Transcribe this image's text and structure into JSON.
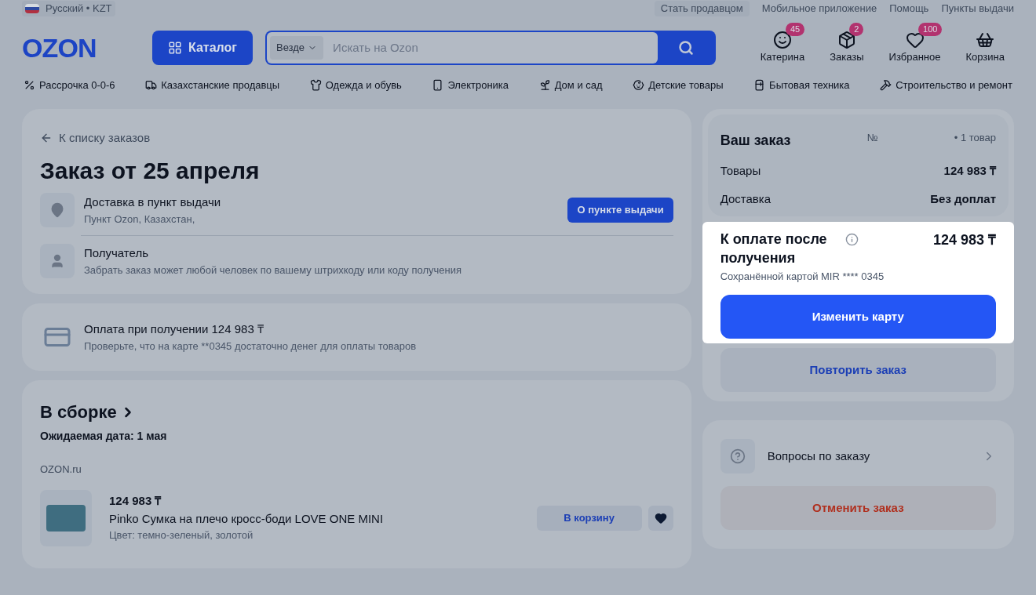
{
  "top_bar": {
    "locale": "Русский • KZT",
    "links": [
      "Стать продавцом",
      "Мобильное приложение",
      "Помощь",
      "Пункты выдачи"
    ]
  },
  "header": {
    "logo": "OZON",
    "catalog_button": "Каталог",
    "search": {
      "scope": "Везде",
      "placeholder": "Искать на Ozon"
    },
    "actions": [
      {
        "kind": "profile",
        "label": "Катерина",
        "badge": "45"
      },
      {
        "kind": "orders",
        "label": "Заказы",
        "badge": "2"
      },
      {
        "kind": "favorites",
        "label": "Избранное",
        "badge": "100"
      },
      {
        "kind": "cart",
        "label": "Корзина"
      }
    ]
  },
  "categories": [
    {
      "kind": "installment",
      "label": "Рассрочка 0-0-6"
    },
    {
      "kind": "truck",
      "label": "Казахстанские продавцы"
    },
    {
      "kind": "clothes",
      "label": "Одежда и обувь"
    },
    {
      "kind": "phone",
      "label": "Электроника"
    },
    {
      "kind": "plant",
      "label": "Дом и сад"
    },
    {
      "kind": "baby",
      "label": "Детские товары"
    },
    {
      "kind": "appliance",
      "label": "Бытовая техника"
    },
    {
      "kind": "tools",
      "label": "Строительство и ремонт"
    }
  ],
  "order": {
    "back_link": "К списку заказов",
    "title": "Заказ от 25 апреля",
    "delivery": {
      "title": "Доставка в пункт выдачи",
      "subtitle": "Пункт Ozon, Казахстан,",
      "button": "О пункте выдачи"
    },
    "recipient": {
      "title": "Получатель",
      "subtitle": "Забрать заказ может любой человек по вашему штрихкоду или коду получения"
    }
  },
  "payment": {
    "title": "Оплата при получении 124 983 ₸",
    "subtitle": "Проверьте, что на карте **0345 достаточно денег для оплаты товаров"
  },
  "shipment": {
    "status": "В сборке",
    "expected": "Ожидаемая дата: 1 мая",
    "seller": "OZON.ru",
    "item": {
      "price": "124 983 ₸",
      "name": "Pinko Сумка на плечо кросс-боди LOVE ONE MINI",
      "variant": "Цвет: темно-зеленый, золотой",
      "cart_button": "В корзину",
      "favorite": true
    }
  },
  "summary": {
    "title": "Ваш заказ",
    "number_label": "№",
    "count": "• 1 товар",
    "rows": [
      {
        "label": "Товары",
        "value": "124 983 ₸"
      },
      {
        "label": "Доставка",
        "value": "Без доплат"
      }
    ],
    "pay": {
      "highlighted": true,
      "title": "К оплате после получения",
      "amount": "124 983 ₸",
      "card": "Сохранённой картой MIR **** 0345",
      "change_button": "Изменить карту"
    },
    "repeat_button": "Повторить заказ"
  },
  "help": {
    "question": "Вопросы по заказу",
    "cancel": "Отменить заказ"
  }
}
